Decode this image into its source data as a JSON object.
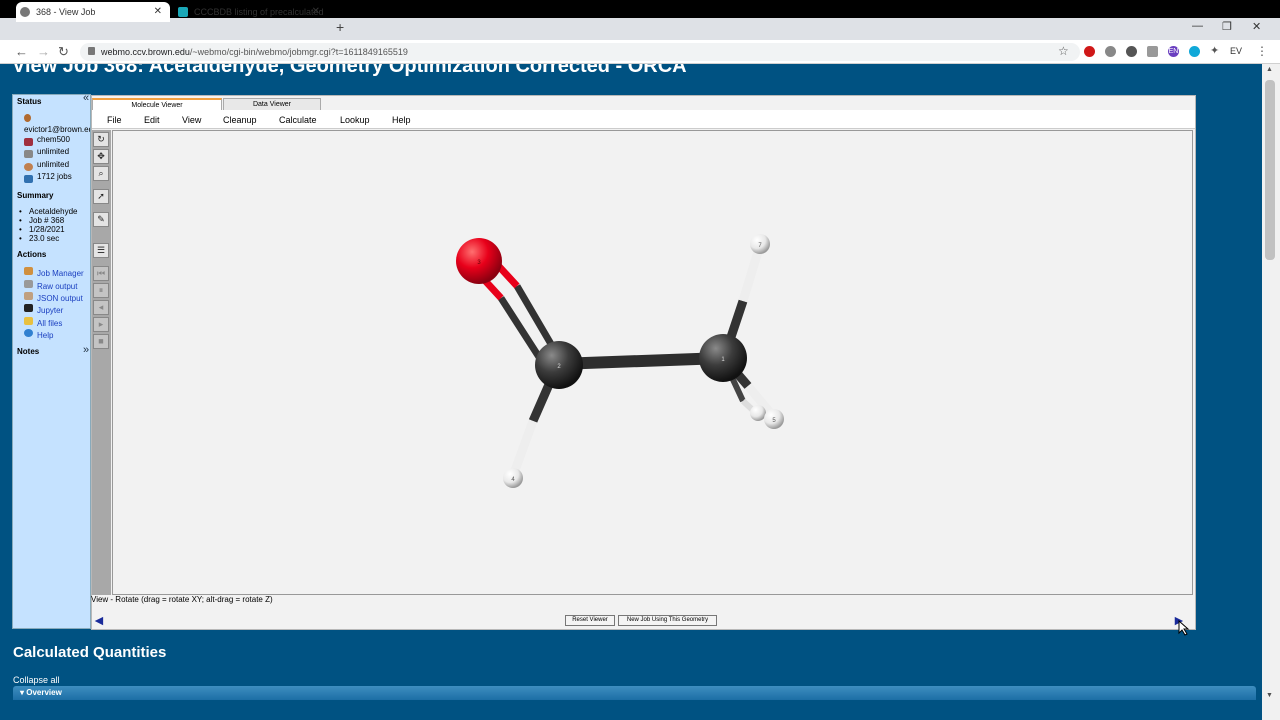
{
  "browser": {
    "tabs": [
      {
        "label": "368 - View Job"
      },
      {
        "label": "CCCBDB listing of precalculated"
      }
    ],
    "url_domain": "webmo.ccv.brown.edu",
    "url_path": "/~webmo/cgi-bin/webmo/jobmgr.cgi?t=1611849165519",
    "profile_initials": "EV",
    "ext_label": "EN",
    "minimize": "—",
    "maximize": "❐",
    "close": "✕",
    "new_tab": "+",
    "back": "←",
    "forward": "→",
    "reload": "↻",
    "star": "☆",
    "menu": "⋮",
    "puzzle": "✦"
  },
  "page": {
    "title": "View Job 368: Acetaldehyde, Geometry Optimization Corrected - ORCA"
  },
  "sidebar": {
    "status_heading": "Status",
    "status_items": [
      "evictor1@brown.edu",
      "chem500",
      "unlimited",
      "unlimited",
      "1712 jobs"
    ],
    "summary_heading": "Summary",
    "summary_items": [
      "Acetaldehyde",
      "Job # 368",
      "1/28/2021",
      "23.0 sec"
    ],
    "actions_heading": "Actions",
    "actions": [
      "Job Manager",
      "Raw output",
      "JSON output",
      "Jupyter",
      "All files",
      "Help"
    ],
    "notes_heading": "Notes",
    "collapse": "«",
    "expand": "»"
  },
  "viewer": {
    "tabs": [
      "Molecule Viewer",
      "Data Viewer"
    ],
    "menu": [
      "File",
      "Edit",
      "View",
      "Cleanup",
      "Calculate",
      "Lookup",
      "Help"
    ],
    "status_text": "View - Rotate (drag = rotate XY; alt-drag = rotate Z)",
    "buttons": [
      "Reset Viewer",
      "New Job Using This Geometry"
    ],
    "atoms": [
      {
        "label": "1",
        "element": "C"
      },
      {
        "label": "2",
        "element": "C"
      },
      {
        "label": "3",
        "element": "O"
      },
      {
        "label": "4",
        "element": "H"
      },
      {
        "label": "5",
        "element": "H"
      },
      {
        "label": "7",
        "element": "H"
      }
    ],
    "colors": {
      "carbon": "#3c3c3c",
      "oxygen": "#e8001a",
      "hydrogen": "#f0f0f0"
    },
    "prev_arrow": "◄",
    "next_arrow": "►"
  },
  "calculated": {
    "title": "Calculated Quantities",
    "collapse_all": "Collapse all",
    "overview": "Overview"
  }
}
